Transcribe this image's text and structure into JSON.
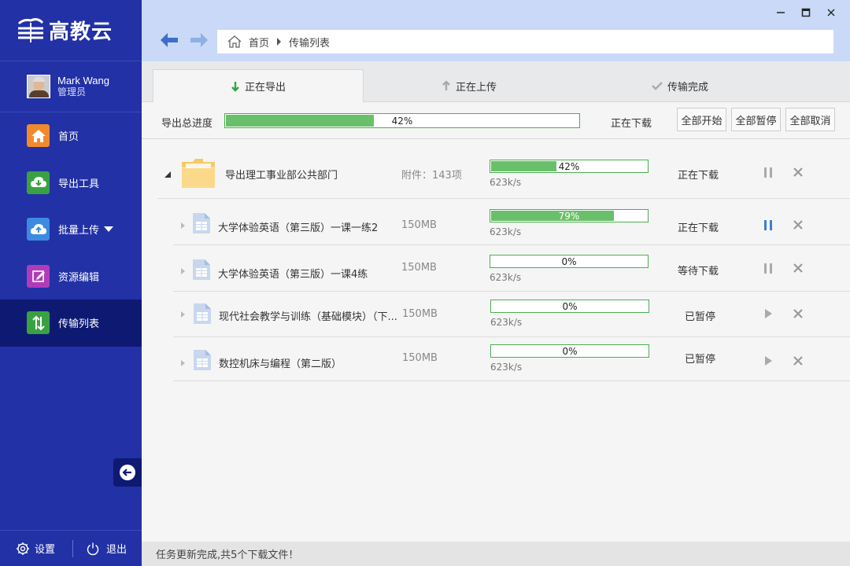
{
  "app": {
    "logo_text": "高教云"
  },
  "user": {
    "name": "Mark Wang",
    "role": "管理员"
  },
  "sidebar": {
    "items": [
      {
        "label": "首页",
        "icon": "home-icon",
        "color": "#f08a2c"
      },
      {
        "label": "导出工具",
        "icon": "cloud-download-icon",
        "color": "#3aa142"
      },
      {
        "label": "批量上传",
        "icon": "cloud-upload-icon",
        "color": "#3d8ae0"
      },
      {
        "label": "资源编辑",
        "icon": "edit-icon",
        "color": "#b03cb8"
      },
      {
        "label": "传输列表",
        "icon": "transfer-icon",
        "color": "#3aa142"
      }
    ],
    "active_index": 4,
    "settings_label": "设置",
    "logout_label": "退出"
  },
  "breadcrumb": {
    "home": "首页",
    "current": "传输列表"
  },
  "tabs": [
    {
      "label": "正在导出",
      "icon": "arrow-down-icon",
      "active": true
    },
    {
      "label": "正在上传",
      "icon": "arrow-up-icon",
      "active": false
    },
    {
      "label": "传输完成",
      "icon": "check-icon",
      "active": false
    }
  ],
  "summary": {
    "label": "导出总进度",
    "progress": 0.42,
    "progress_text": "42%",
    "status": "正在下载",
    "buttons": {
      "start_all": "全部开始",
      "pause_all": "全部暂停",
      "cancel_all": "全部取消"
    }
  },
  "folder": {
    "name": "导出理工事业部公共部门",
    "attachments": "附件：143项",
    "progress": 0.42,
    "progress_text": "42%",
    "speed": "623k/s",
    "status": "正在下载"
  },
  "files": [
    {
      "name": "大学体验英语（第三版）一课一练2",
      "size": "150MB",
      "progress": 0.79,
      "progress_text": "79%",
      "speed": "623k/s",
      "status": "正在下载",
      "action": "pause",
      "action_active": true
    },
    {
      "name": "大学体验英语（第三版）一课4练",
      "size": "150MB",
      "progress": 0,
      "progress_text": "0%",
      "speed": "623k/s",
      "status": "等待下载",
      "action": "pause",
      "action_active": false
    },
    {
      "name": "现代社会教学与训练（基础模块）（下...",
      "size": "150MB",
      "progress": 0,
      "progress_text": "0%",
      "speed": "623k/s",
      "status": "已暂停",
      "action": "play",
      "action_active": false
    },
    {
      "name": "数控机床与编程（第二版）",
      "size": "150MB",
      "progress": 0,
      "progress_text": "0%",
      "speed": "623k/s",
      "status": "已暂停",
      "action": "play",
      "action_active": false
    }
  ],
  "statusbar": {
    "text": "任务更新完成,共5个下载文件！"
  },
  "colors": {
    "sidebar_bg": "#2231a6",
    "sidebar_active": "#0e1a72",
    "progress_fill": "#6ac06a",
    "progress_border": "#4caf50",
    "accent_blue": "#3d7fd6"
  }
}
